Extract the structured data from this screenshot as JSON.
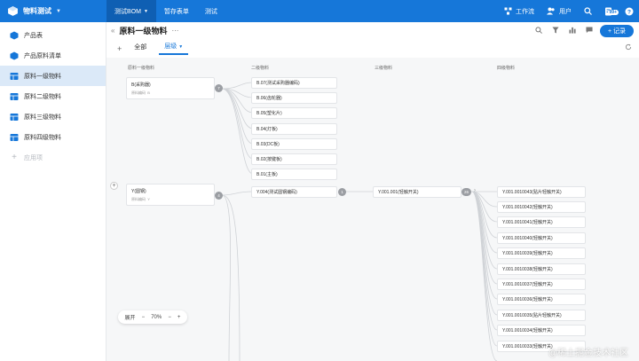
{
  "app": {
    "name": "物料测试"
  },
  "nav": {
    "tabs": [
      {
        "label": "测试BOM"
      },
      {
        "label": "暂存表单"
      },
      {
        "label": "测试"
      }
    ]
  },
  "topright": {
    "workbench": "工作流",
    "users": "用户",
    "badge": "99+"
  },
  "sidebar": {
    "items": [
      {
        "label": "产品表"
      },
      {
        "label": "产品原料清单"
      },
      {
        "label": "原料一级物料"
      },
      {
        "label": "原料二级物料"
      },
      {
        "label": "原料三级物料"
      },
      {
        "label": "原料四级物料"
      }
    ],
    "add_label": "应用项"
  },
  "page": {
    "title": "原料一级物料",
    "add_button": "+ 记录",
    "view_all": "全部",
    "view_active": "层级"
  },
  "columns": [
    "原料一级物料",
    "二级物料",
    "三级物料",
    "四级物料"
  ],
  "level1": [
    {
      "name": "B(采购器)",
      "sub_label": "原料编码",
      "sub_value": "B",
      "count": "7"
    },
    {
      "name": "Y(圆钢)",
      "sub_label": "原料编码",
      "sub_value": "Y",
      "count": "4"
    }
  ],
  "level2": [
    "B.07(测试采购器编码)",
    "B.06(齿轮器)",
    "B.05(塑化片)",
    "B.04(灯板)",
    "B.03(DC板)",
    "B.02(按键板)",
    "B.01(主板)",
    "Y.004(测试圆钢编码)"
  ],
  "level2_count": "1",
  "level3": [
    {
      "name": "Y.001.001(轻触开关)",
      "count": "26"
    }
  ],
  "level4": [
    "Y.001.0010043(贴片轻触开关)",
    "Y.001.0010042(轻触开关)",
    "Y.001.0010041(轻触开关)",
    "Y.001.0010040(轻触开关)",
    "Y.001.0010039(轻触开关)",
    "Y.001.0010038(轻触开关)",
    "Y.001.0010037(轻触开关)",
    "Y.001.0010036(轻触开关)",
    "Y.001.0010035(贴片轻触开关)",
    "Y.001.0010034(轻触开关)",
    "Y.001.0010033(轻触开关)"
  ],
  "zoom": {
    "label": "展开",
    "value": "70%",
    "minus": "−",
    "plus": "+"
  },
  "watermark": "@稀土掘金技术社区",
  "colors": {
    "primary": "#1677d9",
    "nav_active": "#0f5fb3",
    "sidebar_active": "#dbe9f8"
  }
}
